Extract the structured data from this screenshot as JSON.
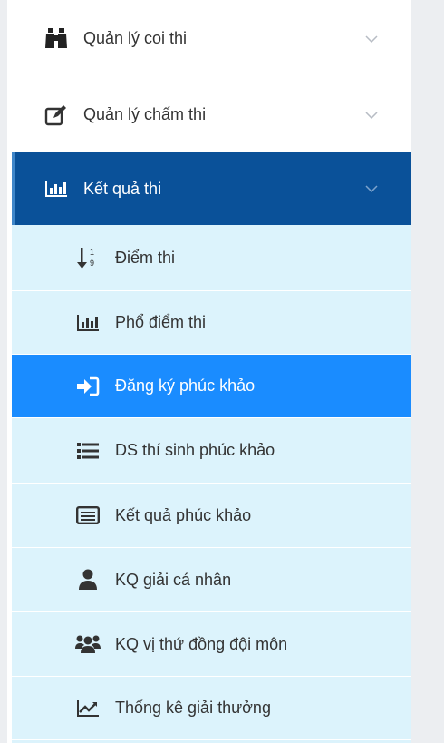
{
  "menu": {
    "top": [
      {
        "label": "Quản lý coi thi",
        "icon": "binoculars-icon"
      },
      {
        "label": "Quản lý chấm thi",
        "icon": "edit-icon"
      },
      {
        "label": "Kết quả thi",
        "icon": "bar-chart-icon",
        "active": true
      }
    ],
    "sub": [
      {
        "label": "Điểm thi",
        "icon": "sort-numeric-icon"
      },
      {
        "label": "Phổ điểm thi",
        "icon": "bar-chart-icon"
      },
      {
        "label": "Đăng ký phúc khảo",
        "icon": "sign-in-icon",
        "selected": true
      },
      {
        "label": "DS thí sinh phúc khảo",
        "icon": "list-icon"
      },
      {
        "label": "Kết quả phúc khảo",
        "icon": "list-alt-icon"
      },
      {
        "label": "KQ giải cá nhân",
        "icon": "user-icon"
      },
      {
        "label": "KQ vị thứ đồng đội môn",
        "icon": "users-icon"
      },
      {
        "label": "Thống kê giải thưởng",
        "icon": "line-chart-icon"
      }
    ]
  },
  "colors": {
    "active_bg": "#0a5199",
    "selected_bg": "#1a8cff",
    "submenu_bg": "#dcf3fc",
    "text": "#333333"
  }
}
